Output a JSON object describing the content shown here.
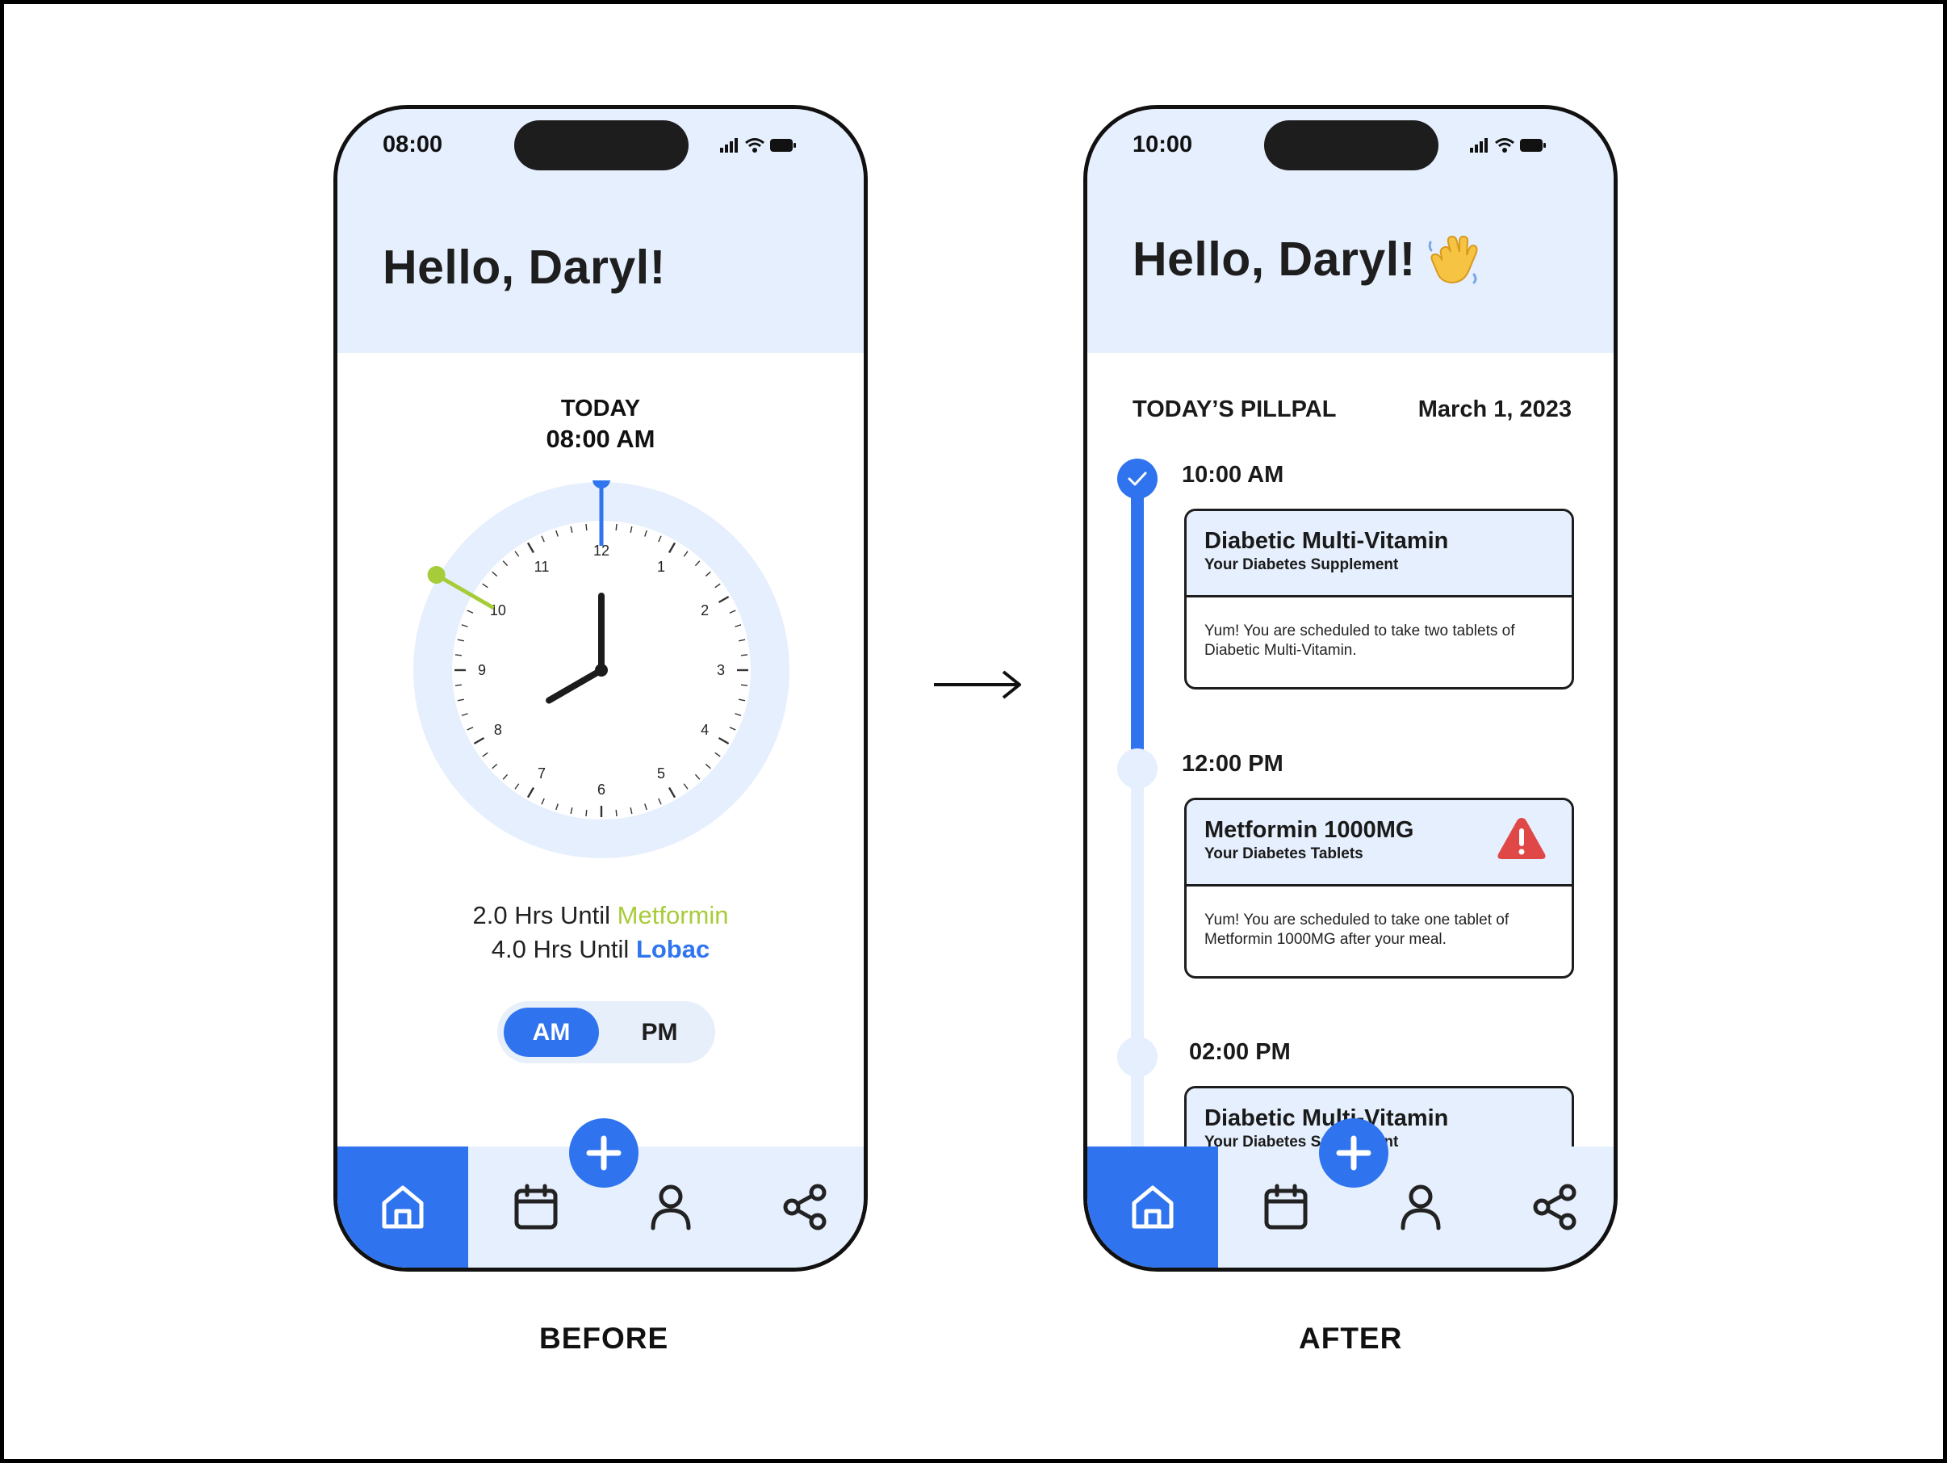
{
  "before": {
    "status_time": "08:00",
    "greeting": "Hello, Daryl!",
    "today_label": "TODAY",
    "today_time": "08:00 AM",
    "clock": {
      "numbers": [
        "12",
        "1",
        "2",
        "3",
        "4",
        "5",
        "6",
        "7",
        "8",
        "9",
        "10",
        "11"
      ],
      "hour": 8,
      "minute": 0,
      "markers": [
        {
          "name": "Metformin",
          "hour": 10,
          "color": "#a7cc39"
        },
        {
          "name": "Lobac",
          "hour": 12,
          "color": "#2f75ee"
        }
      ]
    },
    "countdown": [
      {
        "prefix": "2.0 Hrs Until ",
        "med": "Metformin"
      },
      {
        "prefix": "4.0 Hrs Until ",
        "med": "Lobac"
      }
    ],
    "toggle": {
      "am": "AM",
      "pm": "PM",
      "selected": "AM"
    },
    "caption": "BEFORE"
  },
  "after": {
    "status_time": "10:00",
    "greeting": "Hello, Daryl!",
    "section_title": "TODAY’S PILLPAL",
    "date": "March 1, 2023",
    "schedule": [
      {
        "time": "10:00 AM",
        "title": "Diabetic Multi-Vitamin",
        "subtitle": "Your Diabetes Supplement",
        "body": "Yum! You are scheduled to take two tablets of Diabetic Multi-Vitamin.",
        "status": "done"
      },
      {
        "time": "12:00 PM",
        "title": "Metformin 1000MG",
        "subtitle": "Your Diabetes Tablets",
        "body": "Yum! You are scheduled to take one tablet of Metformin 1000MG after your meal.",
        "status": "warning"
      },
      {
        "time": "02:00 PM",
        "title": "Diabetic Multi-Vitamin",
        "subtitle": "Your Diabetes Supplement",
        "body": "",
        "status": "upcoming"
      }
    ],
    "caption": "AFTER"
  },
  "nav": [
    "home-icon",
    "calendar-icon",
    "user-icon",
    "share-icon"
  ],
  "colors": {
    "accent": "#2f73ee",
    "header_bg": "#e6effd",
    "metformin": "#a7cc39",
    "warning": "#e04848"
  }
}
